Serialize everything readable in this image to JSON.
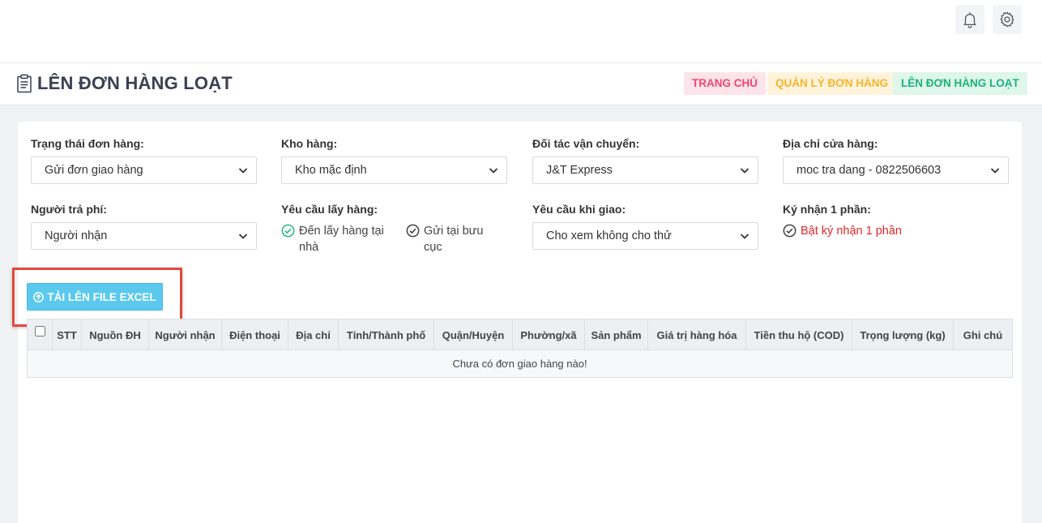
{
  "topbar": {
    "icons": [
      "bell-icon",
      "gear-icon"
    ]
  },
  "header": {
    "title": "LÊN ĐƠN HÀNG LOẠT",
    "breadcrumbs": [
      "TRANG CHỦ",
      "QUẢN LÝ ĐƠN HÀNG",
      "LÊN ĐƠN HÀNG LOẠT"
    ],
    "breadcrumb_colors": [
      "#f0456e",
      "#f7b42c",
      "#1cb37b"
    ]
  },
  "form": {
    "order_status": {
      "label": "Trạng thái đơn hàng:",
      "value": "Gửi đơn giao hàng"
    },
    "warehouse": {
      "label": "Kho hàng:",
      "value": "Kho mặc định"
    },
    "carrier": {
      "label": "Đối tác vận chuyển:",
      "value": "J&T Express"
    },
    "store_address": {
      "label": "Địa chỉ cửa hàng:",
      "value": "moc tra dang - 0822506603"
    },
    "payer": {
      "label": "Người trả phí:",
      "value": "Người nhận"
    },
    "pickup": {
      "label": "Yêu cầu lấy hàng:",
      "options": [
        {
          "label": "Đến lấy hàng tại nhà",
          "selected": true
        },
        {
          "label": "Gửi tại bưu cục",
          "selected": false
        }
      ]
    },
    "delivery_request": {
      "label": "Yêu cầu khi giao:",
      "value": "Cho xem không cho thử"
    },
    "partial_receipt": {
      "label": "Ký nhận 1 phần:",
      "option": "Bật ký nhận 1 phần"
    }
  },
  "upload_button": {
    "label": "TẢI LÊN FILE EXCEL"
  },
  "table": {
    "columns": [
      "STT",
      "Nguồn ĐH",
      "Người nhận",
      "Điện thoại",
      "Địa chỉ",
      "Tỉnh/Thành phố",
      "Quận/Huyện",
      "Phường/xã",
      "Sản phẩm",
      "Giá trị hàng hóa",
      "Tiền thu hộ (COD)",
      "Trọng lượng (kg)",
      "Ghi chú"
    ],
    "empty_message": "Chưa có đơn giao hàng nào!"
  },
  "colors": {
    "accent": "#5bc9ee",
    "success": "#27b97d",
    "danger": "#e8262b",
    "highlight": "#e4483b"
  }
}
